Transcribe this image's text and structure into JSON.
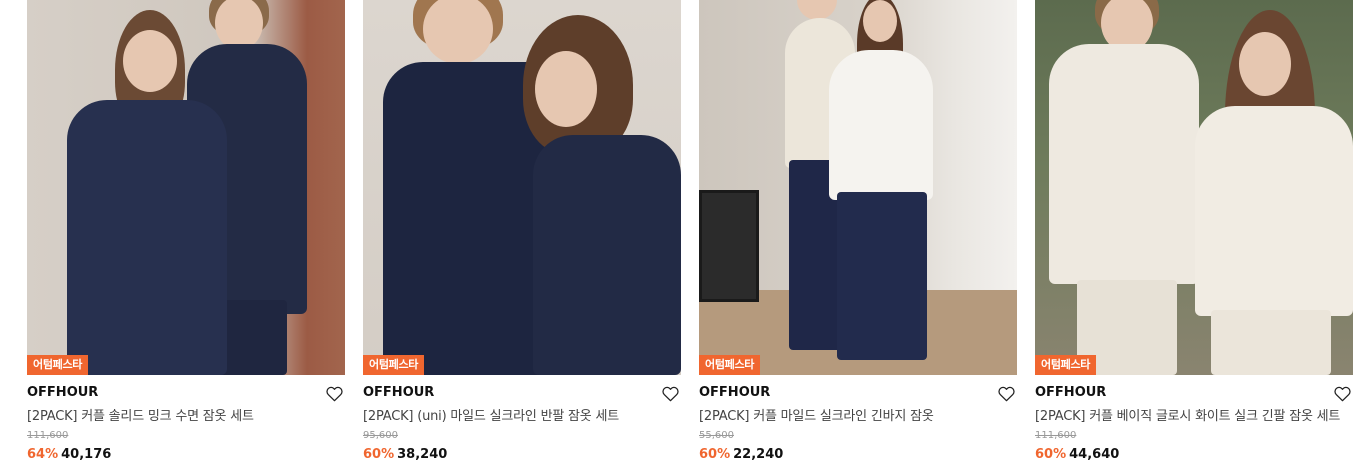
{
  "colors": {
    "badge": "#f0662f",
    "discount": "#f0662f",
    "brand_text": "#111111",
    "name_text": "#444444",
    "original_price": "#999999"
  },
  "products": [
    {
      "badge": "어텀페스타",
      "brand": "OFFHOUR",
      "name": "[2PACK] 커플 솔리드 밍크 수면 잠옷 세트",
      "original_price": "111,600",
      "discount": "64%",
      "price": "40,176",
      "icon": "heart-outline-icon"
    },
    {
      "badge": "어텀페스타",
      "brand": "OFFHOUR",
      "name": "[2PACK] (uni) 마일드 실크라인 반팔 잠옷 세트",
      "original_price": "95,600",
      "discount": "60%",
      "price": "38,240",
      "icon": "heart-outline-icon"
    },
    {
      "badge": "어텀페스타",
      "brand": "OFFHOUR",
      "name": "[2PACK] 커플 마일드 실크라인 긴바지 잠옷",
      "original_price": "55,600",
      "discount": "60%",
      "price": "22,240",
      "icon": "heart-outline-icon"
    },
    {
      "badge": "어텀페스타",
      "brand": "OFFHOUR",
      "name": "[2PACK] 커플 베이직 글로시 화이트 실크 긴팔 잠옷 세트",
      "original_price": "111,600",
      "discount": "60%",
      "price": "44,640",
      "icon": "heart-outline-icon"
    }
  ]
}
